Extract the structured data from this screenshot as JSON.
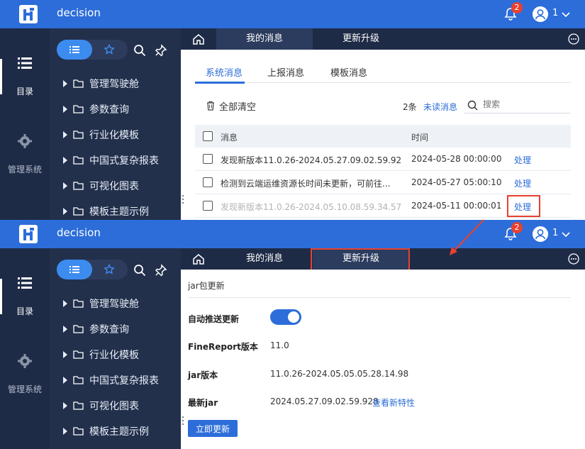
{
  "app": {
    "title": "decision",
    "user_name": "1",
    "notification_count": "2"
  },
  "rail": {
    "catalog_label": "目录",
    "manage_label": "管理系统"
  },
  "tree": {
    "items": [
      "管理驾驶舱",
      "参数查询",
      "行业化模板",
      "中国式复杂报表",
      "可视化图表",
      "模板主题示例"
    ]
  },
  "tabs": {
    "messages_label": "我的消息",
    "update_label": "更新升级"
  },
  "messages": {
    "subtabs": [
      "系统消息",
      "上报消息",
      "模板消息"
    ],
    "clear_all_label": "全部清空",
    "count_text": "2条",
    "unread_label": "未读消息",
    "search_placeholder": "搜索",
    "col_message": "消息",
    "col_time": "时间",
    "rows": [
      {
        "message": "发现新版本11.0.26-2024.05.27.09.02.59.928...",
        "time": "2024-05-28 00:00:00",
        "action": "处理",
        "read": false
      },
      {
        "message": "检测到云端运维资源长时间未更新，可前往...",
        "time": "2024-05-27 05:00:10",
        "action": "处理",
        "read": false
      },
      {
        "message": "发现新版本11.0.26-2024.05.10.08.59.34.577...",
        "time": "2024-05-11 00:00:01",
        "action": "处理",
        "read": true
      }
    ]
  },
  "update": {
    "section_title": "jar包更新",
    "auto_push_label": "自动推送更新",
    "auto_push_enabled": true,
    "fr_version_label": "FineReport版本",
    "fr_version_value": "11.0",
    "jar_version_label": "jar版本",
    "jar_version_value": "11.0.26-2024.05.05.05.28.14.98",
    "latest_jar_label": "最新jar",
    "latest_jar_value": "2024.05.27.09.02.59.928",
    "new_features_link": "查看新特性",
    "update_now_label": "立即更新"
  },
  "colors": {
    "brand": "#2c6dd9",
    "rail": "#1e2b47",
    "tree": "#22304c",
    "highlight": "#e8412f"
  }
}
